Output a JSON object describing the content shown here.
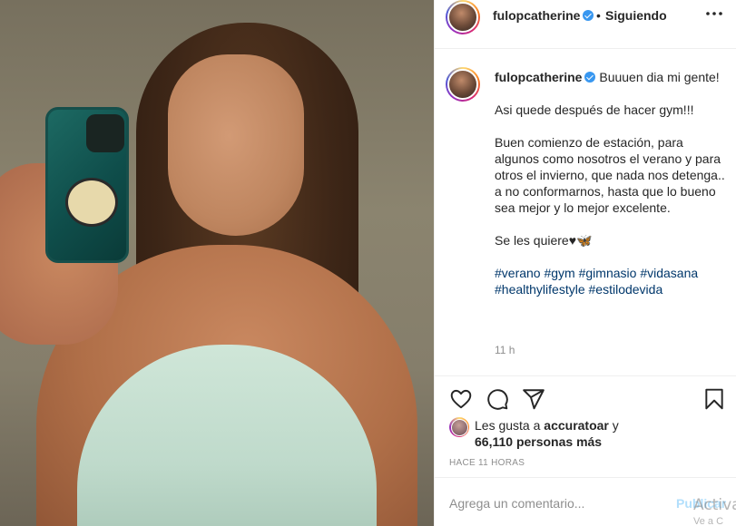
{
  "post": {
    "username": "fulopcatherine",
    "separator": "•",
    "follow_status": "Siguiendo",
    "caption_lines": [
      "Buuuen dia mi gente!",
      "Asi quede después de hacer gym!!!",
      "Buen comienzo de estación, para algunos como nosotros el verano y para otros el invierno, que nada nos detenga.. a no conformarnos, hasta que lo bueno sea mejor y lo mejor excelente.",
      "Se les quiere♥🦋"
    ],
    "hashtags": [
      "#verano",
      "#gym",
      "#gimnasio",
      "#vidasana",
      "#healthylifestyle",
      "#estilodevida"
    ],
    "caption_time": "11 h",
    "likes_prefix": "Les gusta a",
    "likes_user": "accuratoar",
    "likes_and": "y",
    "likes_count": "66,110 personas más",
    "time_ago": "HACE 11 HORAS",
    "comment_placeholder": "Agrega un comentario...",
    "post_button": "Publicar"
  },
  "watermark": {
    "line1": "Activa",
    "line2": "Ve a C"
  },
  "icons": {
    "verified": "verified-badge-icon",
    "more": "more-options-icon",
    "like": "heart-icon",
    "comment": "comment-bubble-icon",
    "share": "paper-plane-icon",
    "save": "bookmark-icon"
  },
  "colors": {
    "hashtag": "#00376b",
    "verified": "#3897f0",
    "muted": "#8e8e8e",
    "post_button_disabled": "#b2dffc"
  }
}
